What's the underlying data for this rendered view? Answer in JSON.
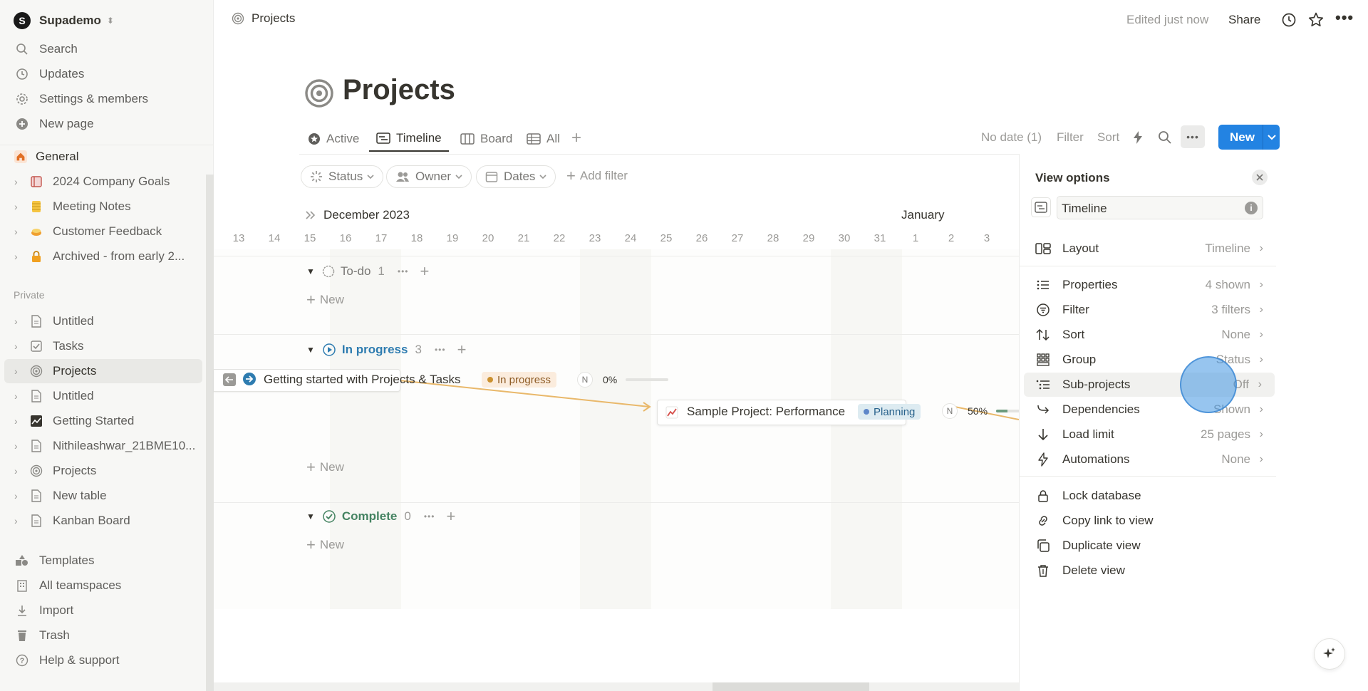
{
  "sidebar": {
    "workspace": "Supademo",
    "workspace_initial": "S",
    "top": [
      {
        "label": "Search",
        "icon": "search-icon"
      },
      {
        "label": "Updates",
        "icon": "clock-icon"
      },
      {
        "label": "Settings & members",
        "icon": "gear-icon"
      },
      {
        "label": "New page",
        "icon": "plus-circle-icon"
      }
    ],
    "teamspace": "General",
    "teamspace_items": [
      "2024 Company Goals",
      "Meeting Notes",
      "Customer Feedback",
      "Archived - from early 2..."
    ],
    "private_label": "Private",
    "private_items": [
      "Untitled",
      "Tasks",
      "Projects",
      "Untitled",
      "Getting Started",
      "Nithileashwar_21BME10...",
      "Projects",
      "New table",
      "Kanban Board"
    ],
    "bottom": [
      "Templates",
      "All teamspaces",
      "Import",
      "Trash",
      "Help & support"
    ]
  },
  "topbar": {
    "breadcrumb": "Projects",
    "edited": "Edited just now",
    "share": "Share"
  },
  "page": {
    "title": "Projects",
    "tabs": [
      "Active",
      "Timeline",
      "Board",
      "All"
    ],
    "toolbar": {
      "no_date": "No date (1)",
      "filter": "Filter",
      "sort": "Sort",
      "new": "New"
    },
    "filters": [
      "Status",
      "Owner",
      "Dates"
    ],
    "add_filter": "Add filter"
  },
  "timeline": {
    "month1": "December 2023",
    "month2": "January",
    "days": [
      "13",
      "14",
      "15",
      "16",
      "17",
      "18",
      "19",
      "20",
      "21",
      "22",
      "23",
      "24",
      "25",
      "26",
      "27",
      "28",
      "29",
      "30",
      "31",
      "1",
      "2",
      "3"
    ],
    "groups": [
      {
        "name": "To-do",
        "count": "1",
        "color": "#787774"
      },
      {
        "name": "In progress",
        "count": "3",
        "color": "#2e7cb0"
      },
      {
        "name": "Complete",
        "count": "0",
        "color": "#448361"
      }
    ],
    "new_label": "New",
    "items": [
      {
        "title": "Getting started with Projects & Tasks",
        "status": "In progress",
        "owner": "N",
        "progress": "0%",
        "progress_value": 0
      },
      {
        "title": "Sample Project: Performance",
        "status": "Planning",
        "owner": "N",
        "progress": "50%",
        "progress_value": 0.5
      }
    ]
  },
  "panel": {
    "title": "View options",
    "view_name": "Timeline",
    "layout": {
      "label": "Layout",
      "value": "Timeline"
    },
    "options": [
      {
        "label": "Properties",
        "value": "4 shown"
      },
      {
        "label": "Filter",
        "value": "3 filters"
      },
      {
        "label": "Sort",
        "value": "None"
      },
      {
        "label": "Group",
        "value": "Status"
      },
      {
        "label": "Sub-projects",
        "value": "Off"
      },
      {
        "label": "Dependencies",
        "value": "Shown"
      },
      {
        "label": "Load limit",
        "value": "25 pages"
      },
      {
        "label": "Automations",
        "value": "None"
      }
    ],
    "actions": [
      "Lock database",
      "Copy link to view",
      "Duplicate view",
      "Delete view"
    ]
  }
}
